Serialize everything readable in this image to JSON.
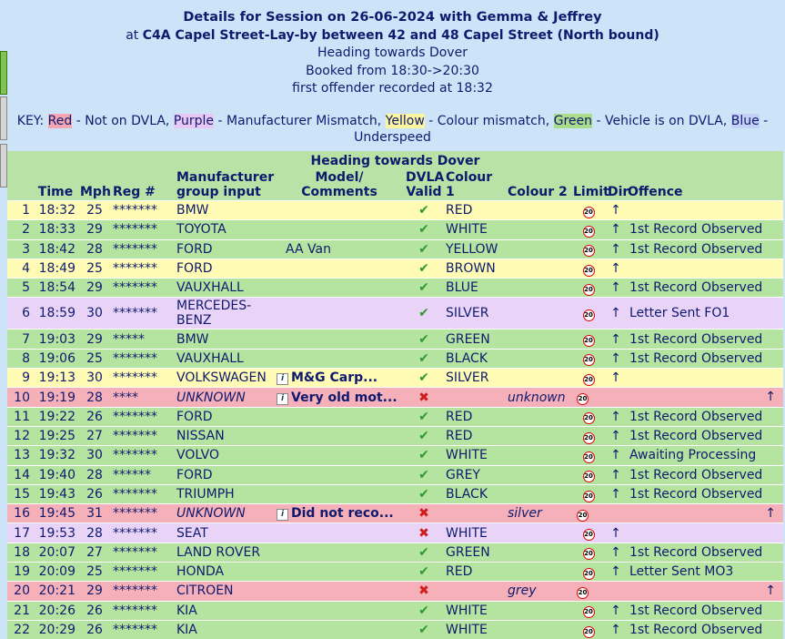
{
  "header": {
    "line1": "Details for Session on 26-06-2024 with Gemma & Jeffrey",
    "line2_prefix": "at ",
    "line2_bold": "C4A Capel Street-Lay-by between 42 and 48 Capel Street (North bound)",
    "line3": "Heading towards Dover",
    "line4": "Booked from 18:30->20:30",
    "line5": "first offender recorded at 18:32"
  },
  "key": {
    "label": "KEY:",
    "red": "Red",
    "red_desc": " - Not on DVLA, ",
    "purple": "Purple",
    "purple_desc": " - Manufacturer Mismatch, ",
    "yellow": "Yellow",
    "yellow_desc": " - Colour mismatch, ",
    "green": "Green",
    "green_desc": " - Vehicle is on DVLA, ",
    "blue": "Blue",
    "blue_desc": " - Underspeed"
  },
  "table": {
    "title": "Heading towards Dover",
    "columns": {
      "time": "Time",
      "mph": "Mph",
      "reg": "Reg #",
      "manufacturer": "Manufacturer group input",
      "model": "Model/ Comments",
      "dvla": "DVLA Valid",
      "colour1": "Colour 1",
      "colour2": "Colour 2",
      "limit": "Limit",
      "dir": "Dir",
      "offence": "Offence"
    },
    "limit_text": "20",
    "arrow": "↑",
    "tick": "✔",
    "cross": "✖",
    "info": "i",
    "rows": [
      {
        "n": "1",
        "time": "18:32",
        "mph": "25",
        "reg": "*******",
        "make": "BMW",
        "model": "",
        "valid": true,
        "c1": "RED",
        "c2": "",
        "offence": "",
        "cls": "yellow"
      },
      {
        "n": "2",
        "time": "18:33",
        "mph": "29",
        "reg": "*******",
        "make": "TOYOTA",
        "model": "",
        "valid": true,
        "c1": "WHITE",
        "c2": "",
        "offence": "1st Record Observed",
        "cls": "green"
      },
      {
        "n": "3",
        "time": "18:42",
        "mph": "28",
        "reg": "*******",
        "make": "FORD",
        "model": "AA Van",
        "valid": true,
        "c1": "YELLOW",
        "c2": "",
        "offence": "1st Record Observed",
        "cls": "green"
      },
      {
        "n": "4",
        "time": "18:49",
        "mph": "25",
        "reg": "*******",
        "make": "FORD",
        "model": "",
        "valid": true,
        "c1": "BROWN",
        "c2": "",
        "offence": "",
        "cls": "yellow"
      },
      {
        "n": "5",
        "time": "18:54",
        "mph": "29",
        "reg": "*******",
        "make": "VAUXHALL",
        "model": "",
        "valid": true,
        "c1": "BLUE",
        "c2": "",
        "offence": "1st Record Observed",
        "cls": "green"
      },
      {
        "n": "6",
        "time": "18:59",
        "mph": "30",
        "reg": "*******",
        "make": "MERCEDES-BENZ",
        "model": "",
        "valid": true,
        "c1": "SILVER",
        "c2": "",
        "offence": "Letter Sent FO1",
        "cls": "purple"
      },
      {
        "n": "7",
        "time": "19:03",
        "mph": "29",
        "reg": "*****",
        "make": "BMW",
        "model": "",
        "valid": true,
        "c1": "GREEN",
        "c2": "",
        "offence": "1st Record Observed",
        "cls": "green"
      },
      {
        "n": "8",
        "time": "19:06",
        "mph": "25",
        "reg": "*******",
        "make": "VAUXHALL",
        "model": "",
        "valid": true,
        "c1": "BLACK",
        "c2": "",
        "offence": "1st Record Observed",
        "cls": "green"
      },
      {
        "n": "9",
        "time": "19:13",
        "mph": "30",
        "reg": "*******",
        "make": "VOLKSWAGEN",
        "model": "M&G Carp...",
        "valid": true,
        "c1": "SILVER",
        "c2": "",
        "offence": "",
        "cls": "yellow"
      },
      {
        "n": "10",
        "time": "19:19",
        "mph": "28",
        "reg": "****",
        "make": "UNKNOWN",
        "model": "Very old mot...",
        "valid": false,
        "c1": "",
        "c2": "unknown",
        "offence": "",
        "cls": "red"
      },
      {
        "n": "11",
        "time": "19:22",
        "mph": "26",
        "reg": "*******",
        "make": "FORD",
        "model": "",
        "valid": true,
        "c1": "RED",
        "c2": "",
        "offence": "1st Record Observed",
        "cls": "green"
      },
      {
        "n": "12",
        "time": "19:25",
        "mph": "27",
        "reg": "*******",
        "make": "NISSAN",
        "model": "",
        "valid": true,
        "c1": "RED",
        "c2": "",
        "offence": "1st Record Observed",
        "cls": "green"
      },
      {
        "n": "13",
        "time": "19:32",
        "mph": "30",
        "reg": "*******",
        "make": "VOLVO",
        "model": "",
        "valid": true,
        "c1": "WHITE",
        "c2": "",
        "offence": "Awaiting Processing",
        "cls": "green"
      },
      {
        "n": "14",
        "time": "19:40",
        "mph": "28",
        "reg": "******",
        "make": "FORD",
        "model": "",
        "valid": true,
        "c1": "GREY",
        "c2": "",
        "offence": "1st Record Observed",
        "cls": "green"
      },
      {
        "n": "15",
        "time": "19:43",
        "mph": "26",
        "reg": "*******",
        "make": "TRIUMPH",
        "model": "",
        "valid": true,
        "c1": "BLACK",
        "c2": "",
        "offence": "1st Record Observed",
        "cls": "green"
      },
      {
        "n": "16",
        "time": "19:45",
        "mph": "31",
        "reg": "*******",
        "make": "UNKNOWN",
        "model": "Did not reco...",
        "valid": false,
        "c1": "",
        "c2": "silver",
        "offence": "",
        "cls": "red"
      },
      {
        "n": "17",
        "time": "19:53",
        "mph": "28",
        "reg": "*******",
        "make": "SEAT",
        "model": "",
        "valid": false,
        "c1": "WHITE",
        "c2": "",
        "offence": "",
        "cls": "purple"
      },
      {
        "n": "18",
        "time": "20:07",
        "mph": "27",
        "reg": "*******",
        "make": "LAND ROVER",
        "model": "",
        "valid": true,
        "c1": "GREEN",
        "c2": "",
        "offence": "1st Record Observed",
        "cls": "green"
      },
      {
        "n": "19",
        "time": "20:09",
        "mph": "25",
        "reg": "*******",
        "make": "HONDA",
        "model": "",
        "valid": true,
        "c1": "RED",
        "c2": "",
        "offence": "Letter Sent MO3",
        "cls": "green"
      },
      {
        "n": "20",
        "time": "20:21",
        "mph": "29",
        "reg": "*******",
        "make": "CITROEN",
        "model": "",
        "valid": false,
        "c1": "",
        "c2": "grey",
        "offence": "",
        "cls": "red"
      },
      {
        "n": "21",
        "time": "20:26",
        "mph": "26",
        "reg": "*******",
        "make": "KIA",
        "model": "",
        "valid": true,
        "c1": "WHITE",
        "c2": "",
        "offence": "1st Record Observed",
        "cls": "green"
      },
      {
        "n": "22",
        "time": "20:29",
        "mph": "26",
        "reg": "*******",
        "make": "KIA",
        "model": "",
        "valid": true,
        "c1": "WHITE",
        "c2": "",
        "offence": "1st Record Observed",
        "cls": "green"
      }
    ]
  }
}
